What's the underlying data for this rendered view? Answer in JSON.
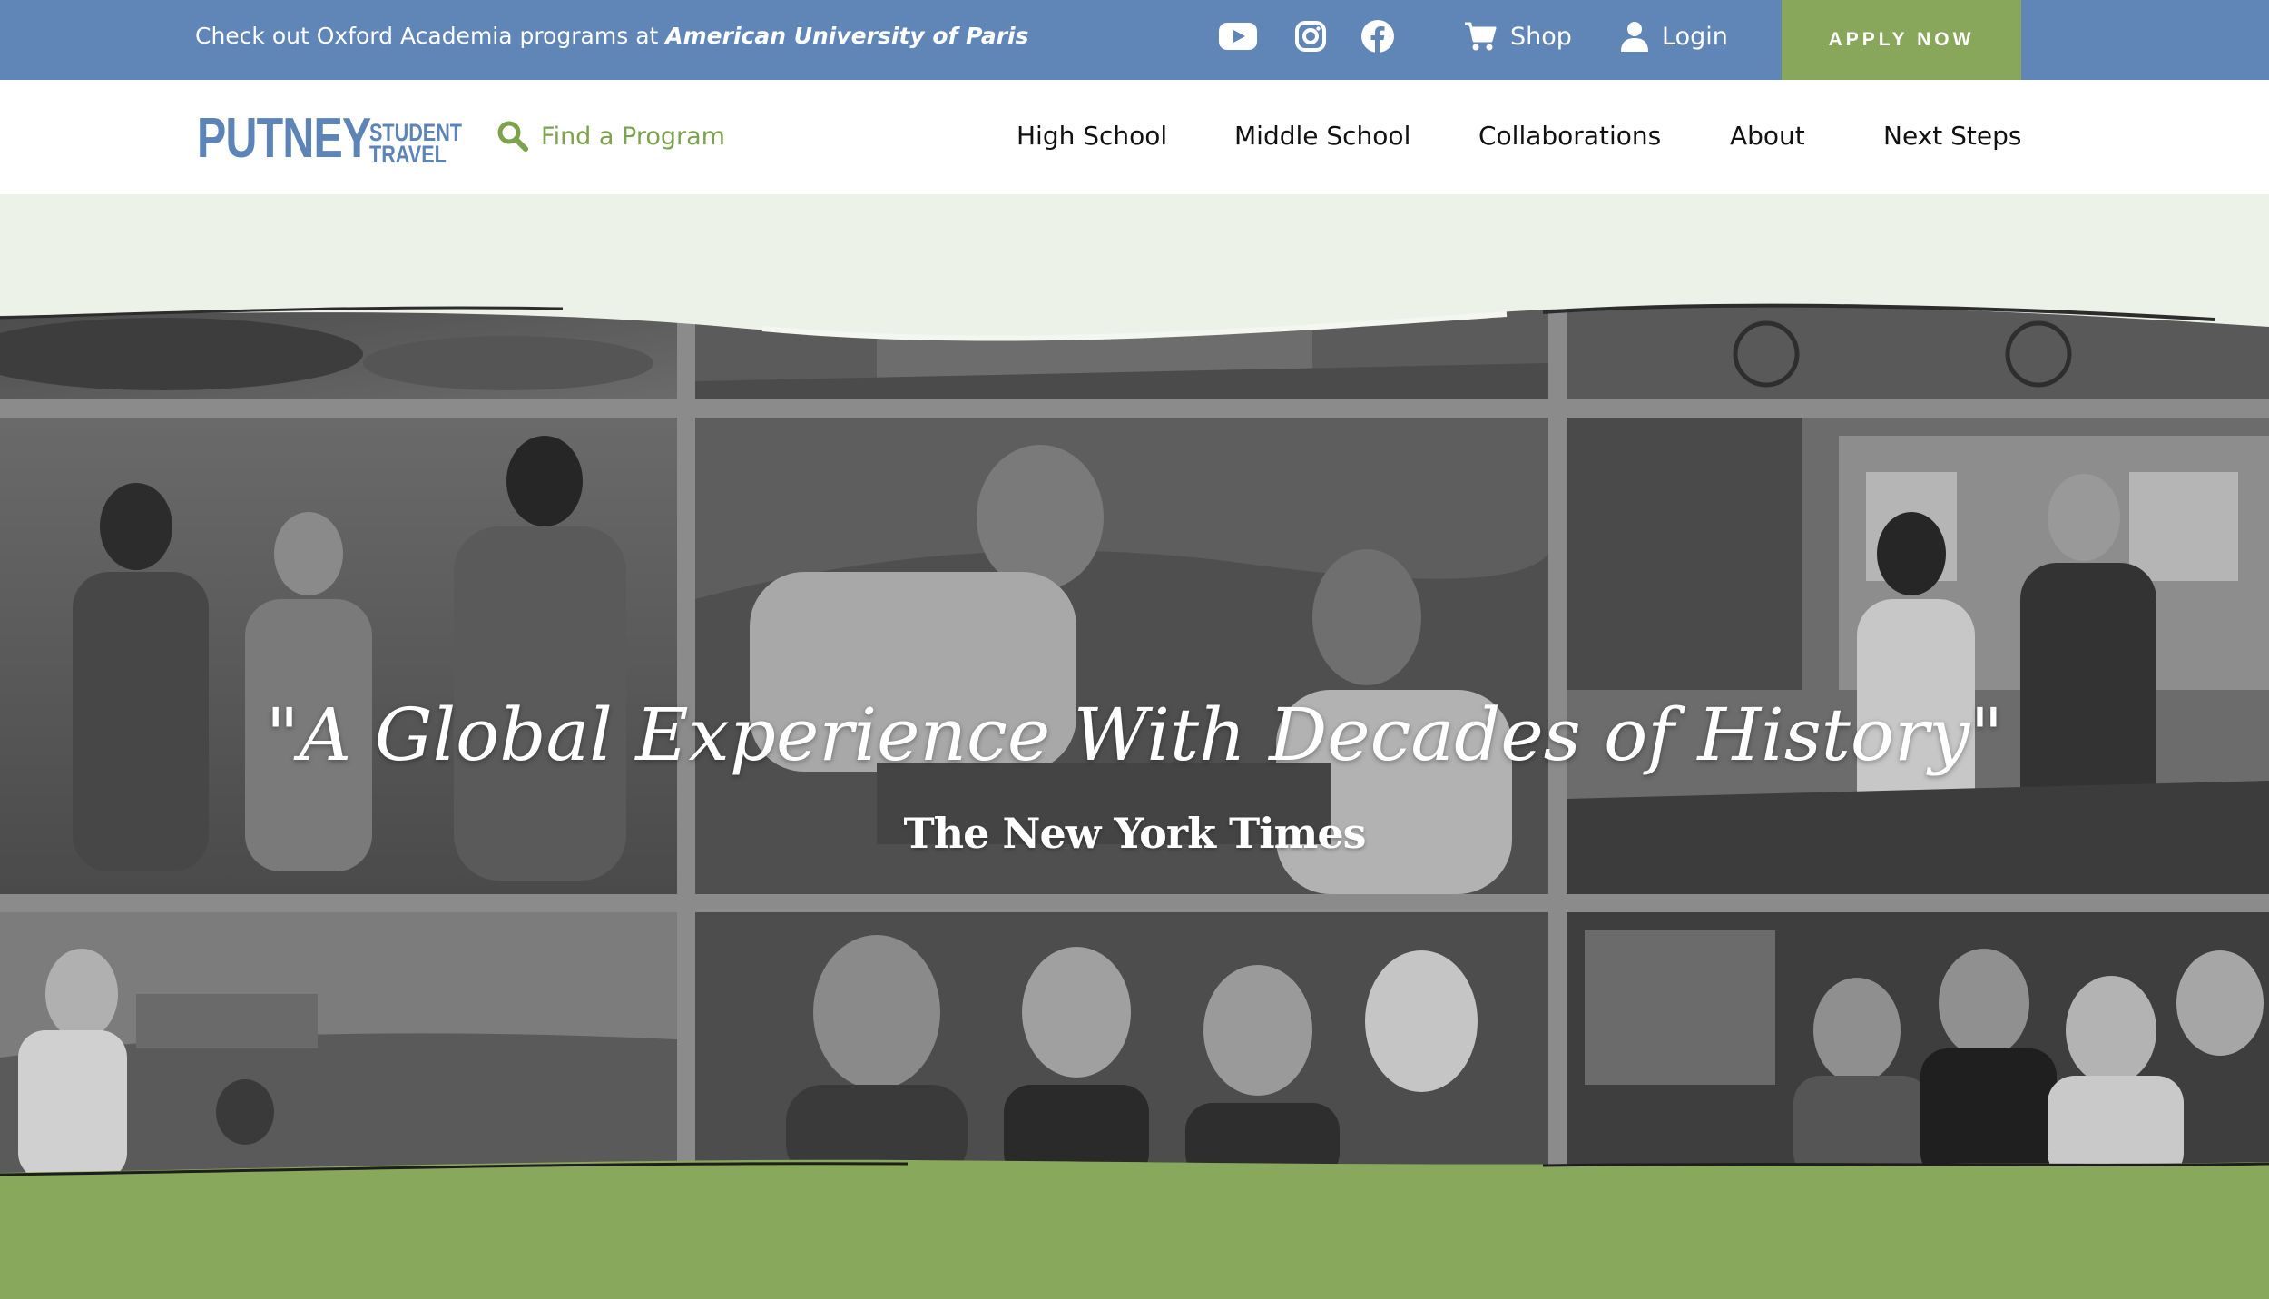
{
  "topbar": {
    "announce_prefix": "Check out Oxford Academia programs at ",
    "announce_link": "American University of Paris",
    "social": [
      "youtube-icon",
      "instagram-icon",
      "facebook-icon"
    ],
    "shop_label": "Shop",
    "login_label": "Login",
    "apply_label": "APPLY NOW"
  },
  "nav": {
    "logo_main": "PUTNEY",
    "logo_sub1": "STUDENT",
    "logo_sub2": "TRAVEL",
    "find_label": "Find a Program",
    "links": [
      "High School",
      "Middle School",
      "Collaborations",
      "About",
      "Next Steps"
    ]
  },
  "hero": {
    "quote": "\"A Global Experience With Decades of History\"",
    "source": "The New York Times"
  },
  "colors": {
    "topbar": "#5f86b6",
    "apply": "#89a75a",
    "accent_green": "#7da24d",
    "hero_band": "#edf2e8",
    "bottom_green": "#88a85c"
  }
}
